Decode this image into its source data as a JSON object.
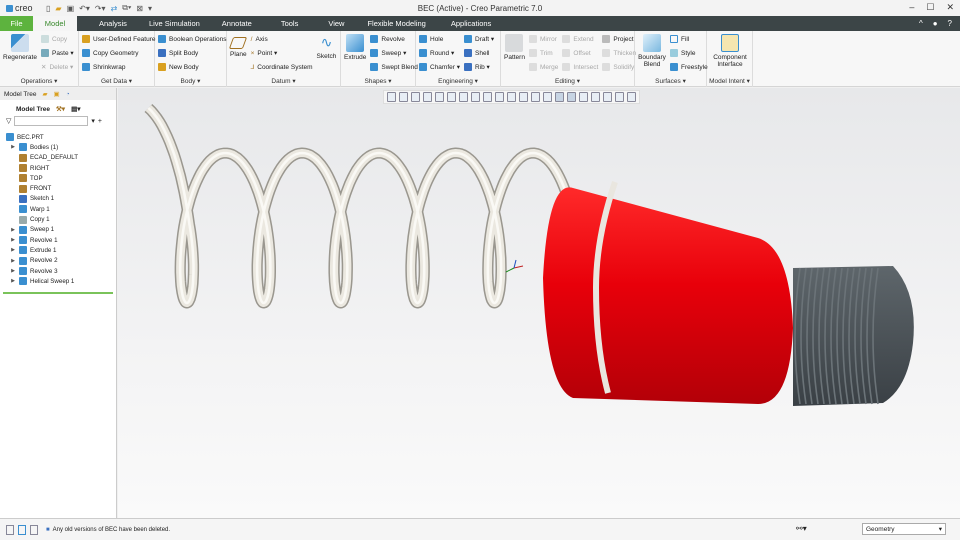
{
  "app": {
    "logo": "creo",
    "window_title": "BEC (Active) - Creo Parametric 7.0"
  },
  "tabs": [
    "File",
    "Model",
    "Analysis",
    "Live Simulation",
    "Annotate",
    "Tools",
    "View",
    "Flexible Modeling",
    "Applications"
  ],
  "ribbon": {
    "operations": {
      "label": "Operations ▾",
      "regenerate": "Regenerate",
      "copy": "Copy",
      "paste": "Paste ▾",
      "delete": "Delete ▾"
    },
    "get_data": {
      "label": "Get Data ▾",
      "udf": "User-Defined Feature",
      "copy_geometry": "Copy Geometry",
      "shrinkwrap": "Shrinkwrap"
    },
    "body": {
      "label": "Body ▾",
      "boolean": "Boolean Operations",
      "split": "Split Body",
      "new": "New Body"
    },
    "datum": {
      "label": "Datum ▾",
      "plane": "Plane",
      "axis": "Axis",
      "point": "Point ▾",
      "csys": "Coordinate System",
      "sketch": "Sketch"
    },
    "shapes": {
      "label": "Shapes ▾",
      "extrude": "Extrude",
      "revolve": "Revolve",
      "sweep": "Sweep ▾",
      "swept_blend": "Swept Blend"
    },
    "engineering": {
      "label": "Engineering ▾",
      "hole": "Hole",
      "round": "Round ▾",
      "chamfer": "Chamfer ▾",
      "draft": "Draft ▾",
      "shell": "Shell",
      "rib": "Rib ▾"
    },
    "editing": {
      "label": "Editing ▾",
      "pattern": "Pattern",
      "mirror": "Mirror",
      "trim": "Trim",
      "merge": "Merge",
      "extend": "Extend",
      "offset": "Offset",
      "intersect": "Intersect",
      "project": "Project",
      "thicken": "Thicken",
      "solidify": "Solidify"
    },
    "surfaces": {
      "label": "Surfaces ▾",
      "boundary_blend": "Boundary Blend",
      "fill": "Fill",
      "style": "Style",
      "freestyle": "Freestyle"
    },
    "model_intent": {
      "label": "Model Intent ▾",
      "component_interface": "Component Interface"
    }
  },
  "model_tree": {
    "tab": "Model Tree",
    "header": "Model Tree",
    "search_placeholder": "",
    "nodes": [
      {
        "label": "BEC.PRT",
        "expand": false,
        "indent": 0,
        "color": "#3a8fd0"
      },
      {
        "label": "Bodies (1)",
        "expand": true,
        "indent": 1,
        "color": "#3a8fd0"
      },
      {
        "label": "ECAD_DEFAULT",
        "expand": false,
        "indent": 1,
        "color": "#b08030"
      },
      {
        "label": "RIGHT",
        "expand": false,
        "indent": 1,
        "color": "#b08030"
      },
      {
        "label": "TOP",
        "expand": false,
        "indent": 1,
        "color": "#b08030"
      },
      {
        "label": "FRONT",
        "expand": false,
        "indent": 1,
        "color": "#b08030"
      },
      {
        "label": "Sketch 1",
        "expand": false,
        "indent": 1,
        "color": "#3a70c0"
      },
      {
        "label": "Warp 1",
        "expand": false,
        "indent": 1,
        "color": "#3a8fd0"
      },
      {
        "label": "Copy 1",
        "expand": false,
        "indent": 1,
        "color": "#9aa"
      },
      {
        "label": "Sweep 1",
        "expand": true,
        "indent": 1,
        "color": "#3a8fd0"
      },
      {
        "label": "Revolve 1",
        "expand": true,
        "indent": 1,
        "color": "#3a8fd0"
      },
      {
        "label": "Extrude 1",
        "expand": true,
        "indent": 1,
        "color": "#3a8fd0"
      },
      {
        "label": "Revolve 2",
        "expand": true,
        "indent": 1,
        "color": "#3a8fd0"
      },
      {
        "label": "Revolve 3",
        "expand": true,
        "indent": 1,
        "color": "#3a8fd0"
      },
      {
        "label": "Helical Sweep 1",
        "expand": true,
        "indent": 1,
        "color": "#3a8fd0"
      }
    ]
  },
  "status": {
    "message": "Any old versions of BEC have been deleted.",
    "filter": "Geometry"
  },
  "colors": {
    "accent": "#5db33e",
    "tabbar": "#3c4547",
    "body_red": "#e8000a",
    "thread_gray": "#4c5358",
    "spring": "#ebe8e0"
  }
}
